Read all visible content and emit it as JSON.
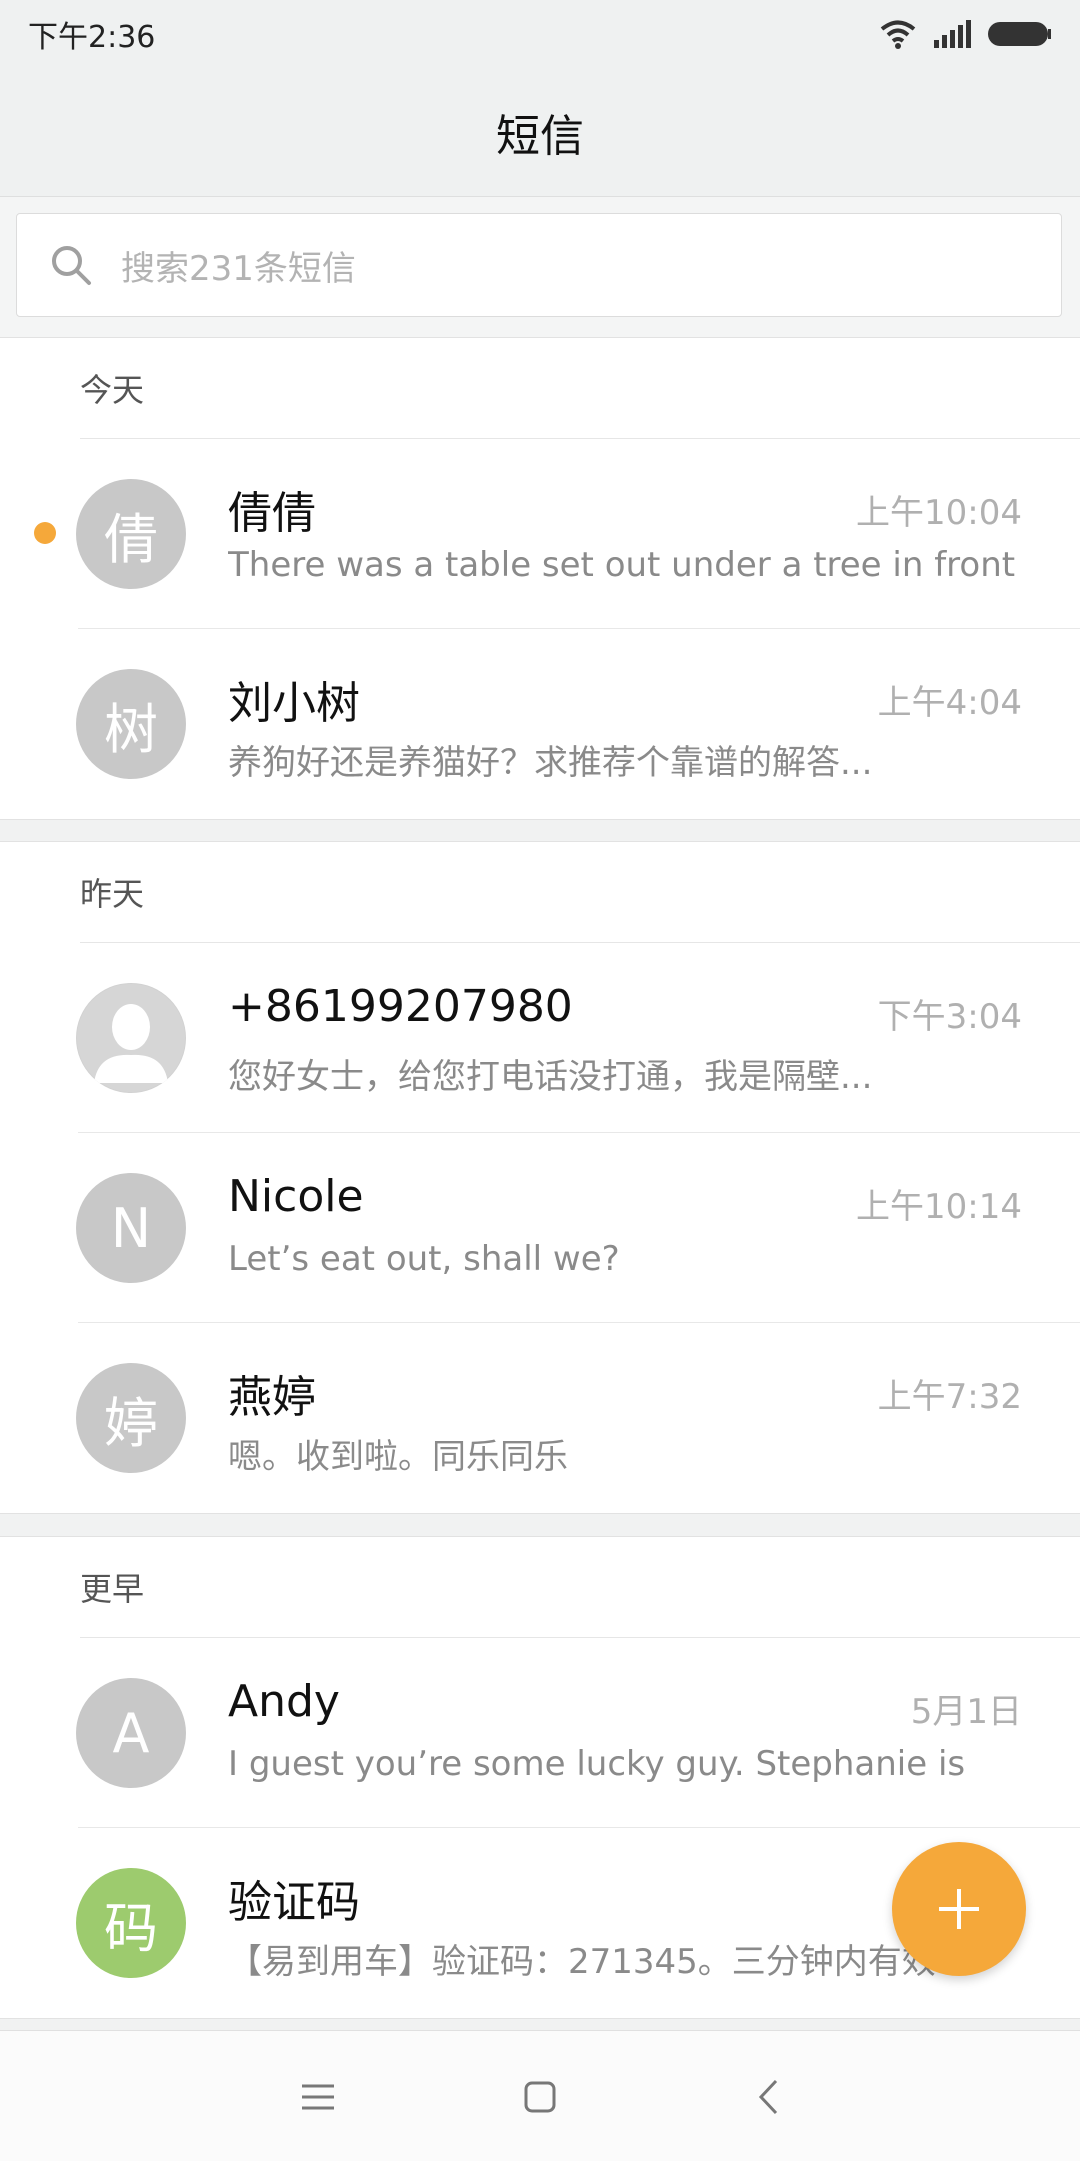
{
  "status_bar": {
    "time": "下午2:36",
    "icons": [
      "wifi-icon",
      "signal-icon",
      "battery-icon"
    ]
  },
  "header": {
    "title": "短信"
  },
  "search": {
    "placeholder": "搜索231条短信"
  },
  "colors": {
    "accent": "#f5a83a",
    "avatar_gray": "#c8c8c8",
    "avatar_green": "#9dcb6e"
  },
  "sections": [
    {
      "label": "今天",
      "items": [
        {
          "avatar": "倩",
          "name": "倩倩",
          "time": "上午10:04",
          "preview": "There was a table set out under a tree in front of",
          "unread": true
        },
        {
          "avatar": "树",
          "name": "刘小树",
          "time": "上午4:04",
          "preview": "养狗好还是养猫好？求推荐个靠谱的解答..."
        }
      ]
    },
    {
      "label": "昨天",
      "items": [
        {
          "avatar": "person-placeholder-icon",
          "name": "+86199207980",
          "time": "下午3:04",
          "preview": "您好女士，给您打电话没打通，我是隔壁..."
        },
        {
          "avatar": "N",
          "name": "Nicole",
          "time": "上午10:14",
          "preview": "Let’s eat out, shall we?"
        },
        {
          "avatar": "婷",
          "name": "燕婷",
          "time": "上午7:32",
          "preview": "嗯。收到啦。同乐同乐"
        }
      ]
    },
    {
      "label": "更早",
      "items": [
        {
          "avatar": "A",
          "name": "Andy",
          "time": "5月1日",
          "preview": "I guest you’re some lucky guy. Stephanie is"
        },
        {
          "avatar": "码",
          "name": "验证码",
          "time": "",
          "preview": "【易到用车】验证码：271345。三分钟内有效..."
        }
      ]
    }
  ],
  "nav": {
    "buttons": [
      "menu-icon",
      "home-icon",
      "back-icon"
    ]
  }
}
